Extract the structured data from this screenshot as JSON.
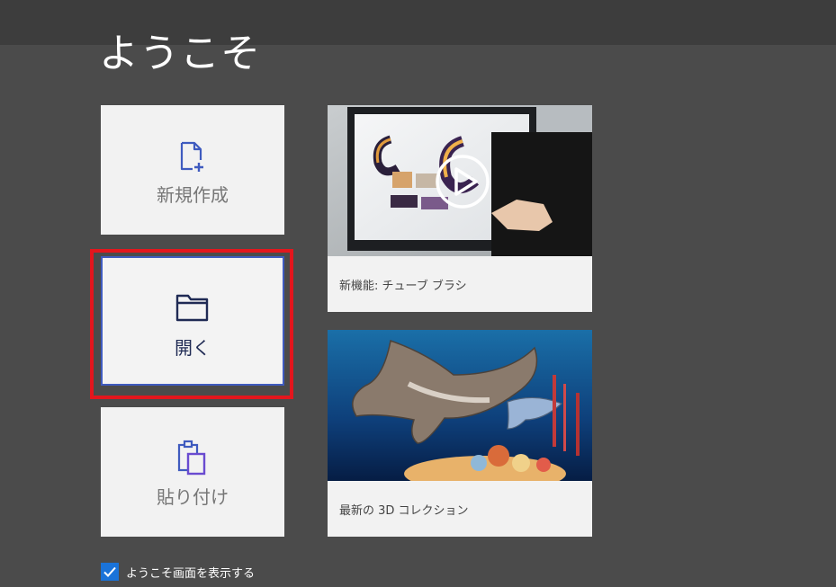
{
  "welcome": {
    "title": "ようこそ"
  },
  "tiles": {
    "new_label": "新規作成",
    "open_label": "開く",
    "paste_label": "貼り付け"
  },
  "cards": {
    "tube_caption": "新機能: チューブ ブラシ",
    "collection_caption": "最新の 3D コレクション"
  },
  "footer": {
    "show_welcome_label": "ようこそ画面を表示する",
    "show_welcome_checked": true
  },
  "icons": {
    "new": "new-file-icon",
    "open": "folder-icon",
    "paste": "paste-icon",
    "play": "play-icon",
    "check": "checkmark-icon"
  },
  "colors": {
    "accent": "#3f5bbf",
    "highlight": "#e3161d",
    "checkbox": "#1a73d9"
  }
}
